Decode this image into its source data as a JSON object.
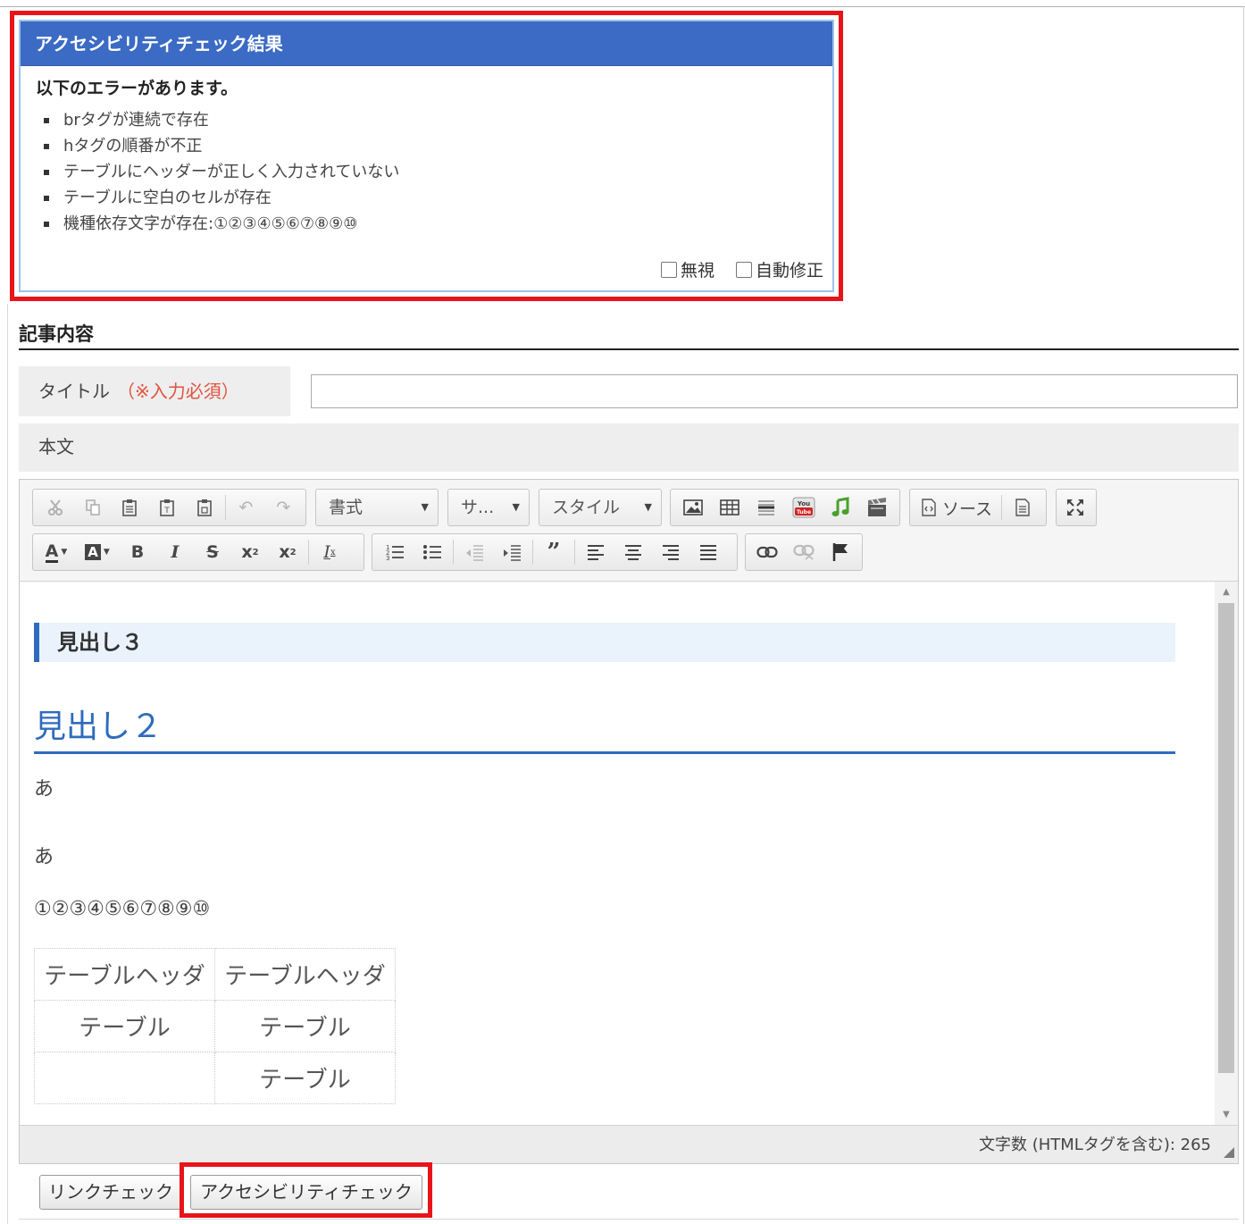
{
  "accessibility": {
    "title": "アクセシビリティチェック結果",
    "lead": "以下のエラーがあります。",
    "errors": [
      "brタグが連続で存在",
      "hタグの順番が不正",
      "テーブルにヘッダーが正しく入力されていない",
      "テーブルに空白のセルが存在",
      "機種依存文字が存在:①②③④⑤⑥⑦⑧⑨⑩"
    ],
    "ignore_label": "無視",
    "autofix_label": "自動修正"
  },
  "section": {
    "title": "記事内容"
  },
  "form": {
    "title_label": "タイトル",
    "required_note": "（※入力必須）",
    "title_value": "",
    "body_label": "本文"
  },
  "toolbar": {
    "format_label": "書式",
    "size_label": "サ...",
    "style_label": "スタイル",
    "source_label": "ソース"
  },
  "content": {
    "h3": "見出し３",
    "h2": "見出し２",
    "para1": "あ",
    "para2": "あ",
    "para3": "①②③④⑤⑥⑦⑧⑨⑩",
    "table": [
      [
        "テーブルヘッダ",
        "テーブルヘッダ"
      ],
      [
        "テーブル",
        "テーブル"
      ],
      [
        "",
        "テーブル"
      ]
    ]
  },
  "footer": {
    "char_count": "文字数 (HTMLタグを含む): 265"
  },
  "buttons": {
    "link_check": "リンクチェック",
    "accessibility_check": "アクセシビリティチェック"
  },
  "colors": {
    "highlight": "#e8141a",
    "panel_header": "#3b6bc4",
    "heading_blue": "#2f6bbd",
    "required": "#e0533f"
  }
}
